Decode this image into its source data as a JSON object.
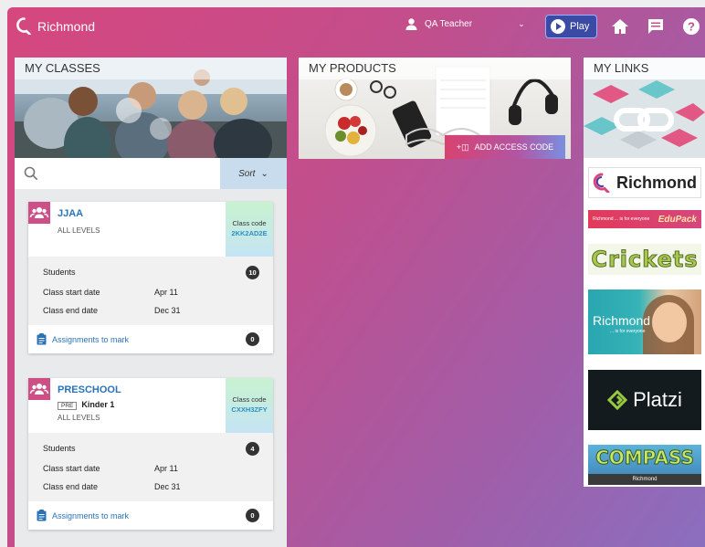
{
  "topbar": {
    "brand": "Richmond",
    "user_name": "QA Teacher",
    "play_label": "Play",
    "icons": [
      "user-icon",
      "chevron-down-icon",
      "play-icon",
      "home-icon",
      "chat-icon",
      "help-icon"
    ]
  },
  "classes_panel": {
    "title": "MY CLASSES",
    "search_placeholder": "",
    "sort_label": "Sort",
    "cards": [
      {
        "name": "JJAA",
        "level_tag": "",
        "level_name": "",
        "levels": "ALL LEVELS",
        "code_label": "Class code",
        "code": "2KK2AD2E",
        "students_label": "Students",
        "students_count": "10",
        "start_label": "Class start date",
        "start_date": "Apr 11",
        "end_label": "Class end date",
        "end_date": "Dec 31",
        "assignments_label": "Assignments to mark",
        "assignments_count": "0"
      },
      {
        "name": "PRESCHOOL",
        "level_tag": "PRE",
        "level_name": "Kinder 1",
        "levels": "ALL LEVELS",
        "code_label": "Class code",
        "code": "CXXH3ZFY",
        "students_label": "Students",
        "students_count": "4",
        "start_label": "Class start date",
        "start_date": "Apr 11",
        "end_label": "Class end date",
        "end_date": "Dec 31",
        "assignments_label": "Assignments to mark",
        "assignments_count": "0"
      }
    ]
  },
  "products_panel": {
    "title": "MY PRODUCTS",
    "add_access_code": "ADD ACCESS CODE"
  },
  "links_panel": {
    "title": "MY LINKS",
    "items": [
      {
        "label": "Richmond"
      },
      {
        "label": "Richmond ... is for everyone",
        "extra": "EduPack"
      },
      {
        "label": "Crickets"
      },
      {
        "label": "Richmond",
        "tagline": "... is for everyone"
      },
      {
        "label": "Platzi"
      },
      {
        "label": "COMPASS",
        "sub": "Richmond"
      }
    ]
  },
  "colors": {
    "brand_pink": "#d6477e",
    "link_blue": "#2b73b8",
    "play_blue": "#3a4aa5"
  }
}
